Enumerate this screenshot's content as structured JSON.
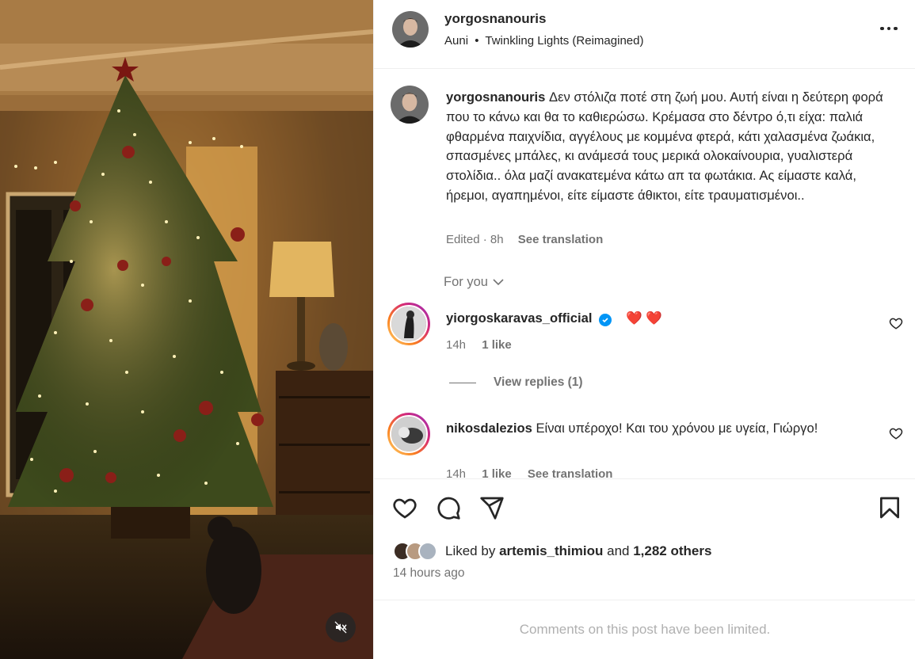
{
  "post": {
    "username": "yorgosnanouris",
    "audio_artist": "Auni",
    "audio_separator": "•",
    "audio_title": "Twinkling Lights (Reimagined)",
    "caption": "Δεν στόλιζα ποτέ στη ζωή μου. Αυτή είναι η δεύτερη φορά που το κάνω και θα το καθιερώσω. Κρέμασα στο δέντρο ό,τι είχα: παλιά φθαρμένα παιχνίδια, αγγέλους με κομμένα φτερά, κάτι χαλασμένα ζωάκια, σπασμένες μπάλες, κι ανάμεσά τους μερικά ολοκαίνουρια, γυαλιστερά στολίδια.. όλα μαζί ανακατεμένα κάτω απ τα φωτάκια. Ας είμαστε καλά, ήρεμοι, αγαπημένοι, είτε είμαστε άθικτοι, είτε τραυματισμένοι..",
    "caption_meta": "Edited · 8h",
    "see_translation": "See translation"
  },
  "comments_section": {
    "filter_label": "For you",
    "comments": [
      {
        "username": "yiorgoskaravas_official",
        "verified": true,
        "text": "❤️ ❤️",
        "time": "14h",
        "likes": "1 like",
        "view_replies": "View replies (1)"
      },
      {
        "username": "nikosdalezios",
        "verified": false,
        "text": "Είναι υπέροχο! Και του χρόνου με υγεία, Γιώργο!",
        "time": "14h",
        "likes": "1 like",
        "see_translation": "See translation"
      }
    ]
  },
  "engagement": {
    "liked_by_prefix": "Liked by",
    "liked_by_user": "artemis_thimiou",
    "liked_by_and": "and",
    "others": "1,282 others",
    "timestamp": "14 hours ago"
  },
  "footer": {
    "limited_notice": "Comments on this post have been limited."
  },
  "icons": {
    "more": "more-options-icon",
    "like": "heart-icon",
    "comment": "comment-icon",
    "share": "share-icon",
    "save": "bookmark-icon",
    "mute": "audio-muted-icon",
    "verified": "verified-badge-icon"
  },
  "colors": {
    "verified": "#0095f6",
    "heart": "#ed4956",
    "secondary_text": "#737373"
  }
}
